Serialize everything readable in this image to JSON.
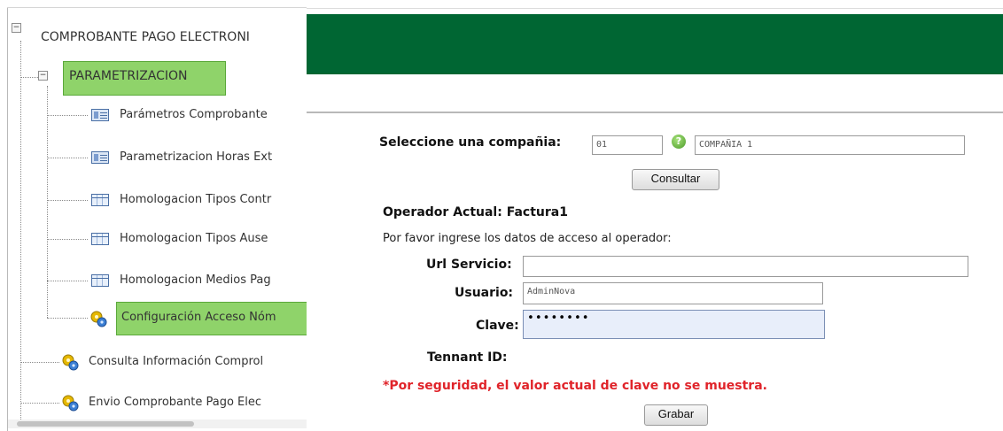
{
  "tree": {
    "root_label": "COMPROBANTE PAGO ELECTRONI",
    "group_label": "PARAMETRIZACION",
    "items": [
      {
        "label": "Parámetros Comprobante",
        "icon": "form-icon"
      },
      {
        "label": "Parametrizacion Horas Ext",
        "icon": "form-icon"
      },
      {
        "label": "Homologacion Tipos Contr",
        "icon": "table-icon"
      },
      {
        "label": "Homologacion Tipos Ause",
        "icon": "table-icon"
      },
      {
        "label": "Homologacion Medios Pag",
        "icon": "table-icon"
      },
      {
        "label": "Configuración Acceso Nóm",
        "icon": "gear-icon",
        "selected": true
      }
    ],
    "root_items": [
      {
        "label": "Consulta Información Comprol",
        "icon": "gear-icon"
      },
      {
        "label": "Envio Comprobante Pago Elec",
        "icon": "gear-icon"
      }
    ],
    "expander_symbol": "−"
  },
  "header": {
    "color": "#006633"
  },
  "company": {
    "label": "Seleccione una compañia:",
    "code_value": "01",
    "help_symbol": "?",
    "name_value": "COMPAÑIA 1",
    "consult_button": "Consultar"
  },
  "operator": {
    "current_label": "Operador Actual: Factura1",
    "instruction": "Por favor ingrese los datos de acceso al operador:",
    "url_label": "Url Servicio:",
    "url_value": "",
    "user_label": "Usuario:",
    "user_value": "AdminNova",
    "password_label": "Clave:",
    "password_value": "••••••••",
    "tenant_label": "Tennant ID:",
    "security_note": "*Por seguridad, el valor actual de clave no se muestra.",
    "save_button": "Grabar"
  },
  "colors": {
    "selected_node": "#8fd36a",
    "warning_text": "#e0242a",
    "header_green": "#006633"
  }
}
